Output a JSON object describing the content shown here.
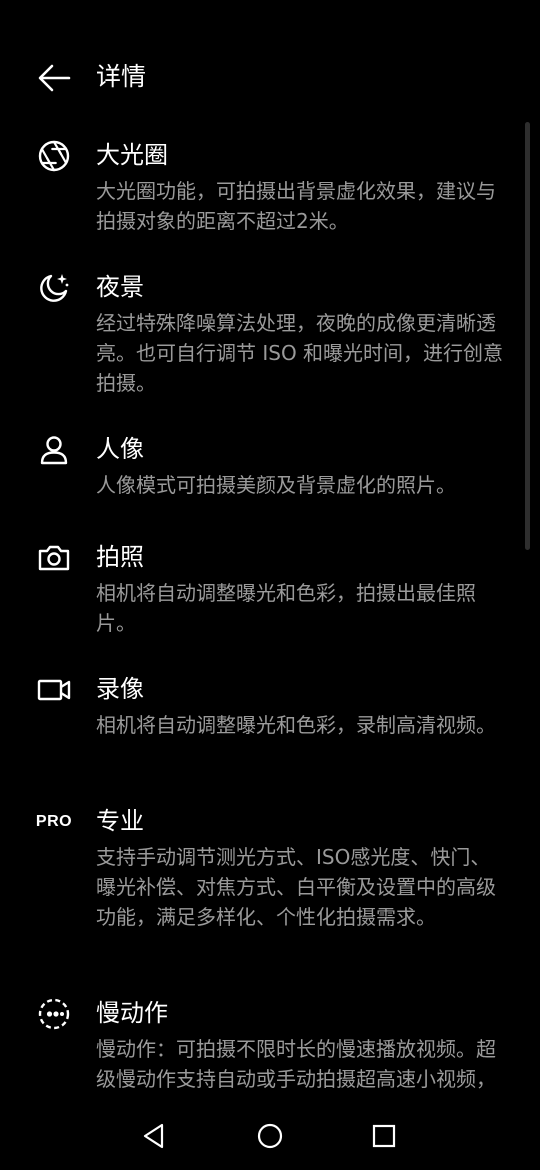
{
  "header": {
    "title": "详情",
    "back_icon": "arrow-left-icon"
  },
  "modes": [
    {
      "icon": "aperture-icon",
      "title": "大光圈",
      "description": "大光圈功能，可拍摄出背景虚化效果，建议与拍摄对象的距离不超过2米。"
    },
    {
      "icon": "moon-stars-icon",
      "title": "夜景",
      "description": "经过特殊降噪算法处理，夜晚的成像更清晰透亮。也可自行调节 ISO 和曝光时间，进行创意拍摄。"
    },
    {
      "icon": "person-icon",
      "title": "人像",
      "description": "人像模式可拍摄美颜及背景虚化的照片。"
    },
    {
      "icon": "camera-icon",
      "title": "拍照",
      "description": "相机将自动调整曝光和色彩，拍摄出最佳照片。"
    },
    {
      "icon": "video-camera-icon",
      "title": "录像",
      "description": "相机将自动调整曝光和色彩，录制高清视频。"
    },
    {
      "icon": "pro-icon",
      "icon_text": "PRO",
      "title": "专业",
      "description": "支持手动调节测光方式、ISO感光度、快门、曝光补偿、对焦方式、白平衡及设置中的高级功能，满足多样化、个性化拍摄需求。"
    },
    {
      "icon": "slow-motion-icon",
      "title": "慢动作",
      "description": "慢动作：可拍摄不限时长的慢速播放视频。超级慢动作支持自动或手动拍摄超高速小视频，明亮环境下拍摄效果更佳。"
    }
  ],
  "navbar": {
    "back_icon": "triangle-back-icon",
    "home_icon": "circle-home-icon",
    "recents_icon": "square-recents-icon"
  },
  "colors": {
    "background": "#000000",
    "title_text": "#ffffff",
    "description_text": "#9a9a9a"
  }
}
